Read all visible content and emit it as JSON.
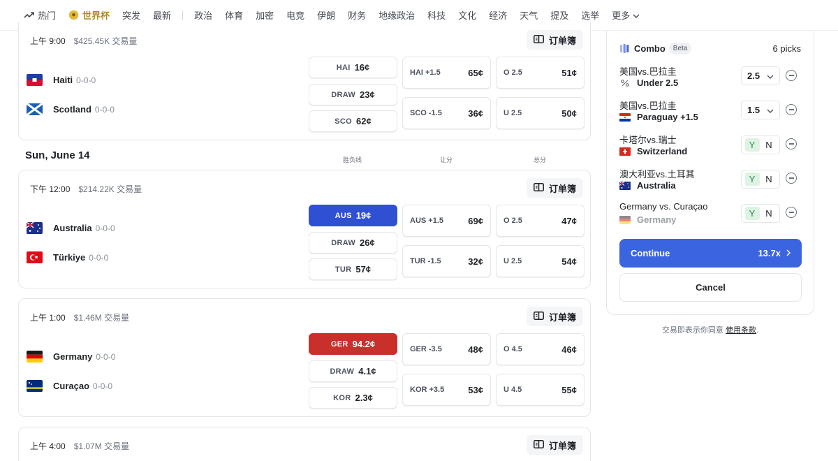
{
  "nav": {
    "items": [
      "热门",
      "世界杯",
      "突发",
      "最新",
      "政治",
      "体育",
      "加密",
      "电竞",
      "伊朗",
      "财务",
      "地缘政治",
      "科技",
      "文化",
      "经济",
      "天气",
      "提及",
      "选举"
    ],
    "more": "更多"
  },
  "colors": {
    "blue_selected": "#3050d4",
    "red_selected": "#c9302c",
    "continue": "#3b64e0",
    "worldcup": "#b38a1f"
  },
  "events": [
    {
      "time": "上午 9:00",
      "volume": "$425.45K 交易量",
      "orderbook": "订单簿",
      "teams": [
        {
          "name": "Haiti",
          "score": "0-0-0",
          "flag": "haiti"
        },
        {
          "name": "Scotland",
          "score": "0-0-0",
          "flag": "scotland"
        }
      ],
      "moneyline": [
        {
          "label": "HAI",
          "price": "16¢",
          "state": "default"
        },
        {
          "label": "DRAW",
          "price": "23¢",
          "state": "default"
        },
        {
          "label": "SCO",
          "price": "62¢",
          "state": "default"
        }
      ],
      "spread": [
        {
          "label": "HAI +1.5",
          "price": "65¢"
        },
        {
          "label": "SCO -1.5",
          "price": "36¢"
        }
      ],
      "total": [
        {
          "label": "O 2.5",
          "price": "51¢"
        },
        {
          "label": "U 2.5",
          "price": "50¢"
        }
      ]
    },
    {
      "time": "下午 12:00",
      "volume": "$214.22K 交易量",
      "orderbook": "订单簿",
      "teams": [
        {
          "name": "Australia",
          "score": "0-0-0",
          "flag": "australia"
        },
        {
          "name": "Türkiye",
          "score": "0-0-0",
          "flag": "turkey"
        }
      ],
      "moneyline": [
        {
          "label": "AUS",
          "price": "19¢",
          "state": "selected-blue"
        },
        {
          "label": "DRAW",
          "price": "26¢",
          "state": "default"
        },
        {
          "label": "TUR",
          "price": "57¢",
          "state": "default"
        }
      ],
      "spread": [
        {
          "label": "AUS +1.5",
          "price": "69¢"
        },
        {
          "label": "TUR -1.5",
          "price": "32¢"
        }
      ],
      "total": [
        {
          "label": "O 2.5",
          "price": "47¢"
        },
        {
          "label": "U 2.5",
          "price": "54¢"
        }
      ]
    },
    {
      "time": "上午 1:00",
      "volume": "$1.46M 交易量",
      "orderbook": "订单簿",
      "teams": [
        {
          "name": "Germany",
          "score": "0-0-0",
          "flag": "germany"
        },
        {
          "name": "Curaçao",
          "score": "0-0-0",
          "flag": "curacao"
        }
      ],
      "moneyline": [
        {
          "label": "GER",
          "price": "94.2¢",
          "state": "selected-red"
        },
        {
          "label": "DRAW",
          "price": "4.1¢",
          "state": "default"
        },
        {
          "label": "KOR",
          "price": "2.3¢",
          "state": "default"
        }
      ],
      "spread": [
        {
          "label": "GER -3.5",
          "price": "48¢"
        },
        {
          "label": "KOR +3.5",
          "price": "53¢"
        }
      ],
      "total": [
        {
          "label": "O 4.5",
          "price": "46¢"
        },
        {
          "label": "U 4.5",
          "price": "55¢"
        }
      ]
    },
    {
      "time": "上午 4:00",
      "volume": "$1.07M 交易量",
      "orderbook": "订单簿"
    }
  ],
  "date_header": "Sun, June 14",
  "column_headers": {
    "moneyline": "胜负线",
    "spread": "让分",
    "total": "总分"
  },
  "slip": {
    "title": "Combo",
    "badge": "Beta",
    "picks_count": "6 picks",
    "picks": [
      {
        "match": "美国vs.巴拉圭",
        "selection": "Under 2.5",
        "control": "select",
        "value": "2.5",
        "icon": "percent-icon"
      },
      {
        "match": "美国vs.巴拉圭",
        "selection": "Paraguay +1.5",
        "control": "select",
        "value": "1.5",
        "icon": "paraguay"
      },
      {
        "match": "卡塔尔vs.瑞士",
        "selection": "Switzerland",
        "control": "yn",
        "yes": "Y",
        "no": "N",
        "icon": "switzerland"
      },
      {
        "match": "澳大利亚vs.土耳其",
        "selection": "Australia",
        "control": "yn",
        "yes": "Y",
        "no": "N",
        "icon": "australia"
      },
      {
        "match": "Germany vs. Curaçao",
        "selection": "Germany",
        "control": "yn",
        "yes": "Y",
        "no": "N",
        "icon": "germany"
      }
    ],
    "continue_label": "Continue",
    "multiplier": "13.7x",
    "cancel_label": "Cancel"
  },
  "terms": {
    "text": "交易即表示你同意",
    "link": "使用条款",
    "suffix": "."
  }
}
